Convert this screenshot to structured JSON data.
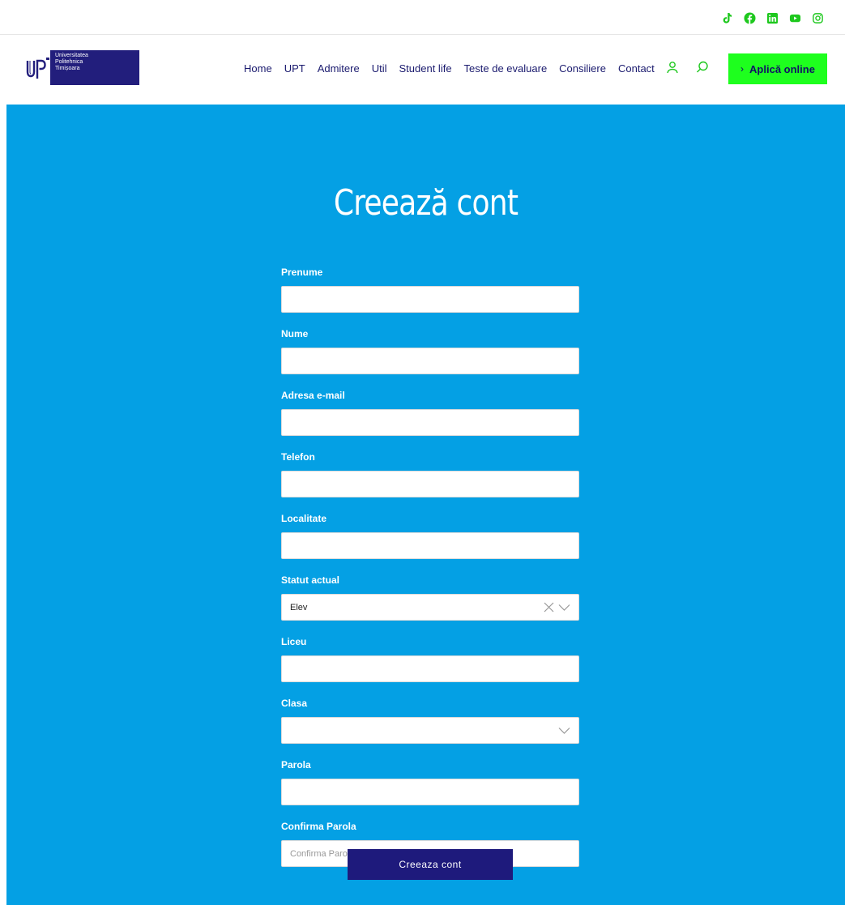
{
  "colors": {
    "brand_blue": "#221e7c",
    "form_background": "#04a0e4",
    "cta_green": "#1eff1e",
    "social_icon_green": "#1ec81e"
  },
  "social": {
    "icons": [
      "tiktok-icon",
      "facebook-icon",
      "linkedin-icon",
      "youtube-icon",
      "instagram-icon"
    ]
  },
  "logo": {
    "mark": "UP",
    "line1": "Universitatea",
    "line2": "Politehnica",
    "line3": "Timișoara"
  },
  "nav": {
    "items": [
      "Home",
      "UPT",
      "Admitere",
      "Util",
      "Student life",
      "Teste de evaluare",
      "Consiliere",
      "Contact"
    ]
  },
  "header": {
    "account_icon": "user-icon",
    "search_icon": "search-icon",
    "apply_label": "Aplică online",
    "apply_chevron": "›"
  },
  "page": {
    "title": "Creează cont"
  },
  "form": {
    "first_name_label": "Prenume",
    "first_name_value": "",
    "last_name_label": "Nume",
    "last_name_value": "",
    "email_label": "Adresa e-mail",
    "email_value": "",
    "phone_label": "Telefon",
    "phone_value": "",
    "city_label": "Localitate",
    "city_value": "",
    "status_label": "Statut actual",
    "status_value": "Elev",
    "school_label": "Liceu",
    "school_value": "",
    "class_label": "Clasa",
    "class_value": "",
    "password_label": "Parola",
    "password_value": "",
    "confirm_label": "Confirma Parola",
    "confirm_placeholder": "Confirma Parola",
    "submit_label": "Creeaza cont"
  }
}
